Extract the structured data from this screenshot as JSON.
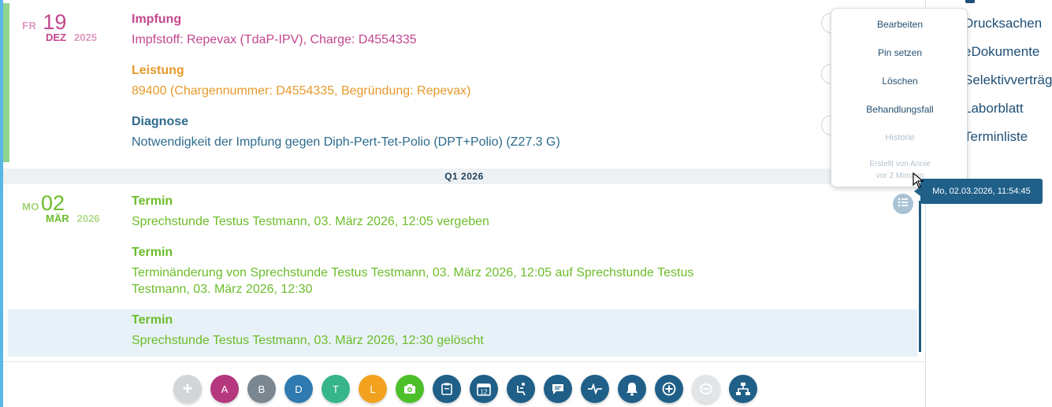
{
  "entries": {
    "dec": {
      "weekday": "FR",
      "day": "19",
      "month": "DEZ",
      "year": "2025",
      "items": [
        {
          "title": "Impfung",
          "text": "Impfstoff: Repevax (TdaP-IPV), Charge: D4554335"
        },
        {
          "title": "Leistung",
          "text": "89400 (Chargennummer: D4554335, Begründung: Repevax)"
        },
        {
          "title": "Diagnose",
          "text": "Notwendigkeit der Impfung gegen Diph-Pert-Tet-Polio (DPT+Polio) (Z27.3 G)"
        }
      ]
    },
    "quarter": "Q1  2026",
    "mar": {
      "weekday": "MO",
      "day": "02",
      "month": "MÄR",
      "year": "2026",
      "items": [
        {
          "title": "Termin",
          "text": "Sprechstunde Testus Testmann, 03. März 2026, 12:05 vergeben"
        },
        {
          "title": "Termin",
          "text": "Terminänderung von Sprechstunde Testus Testmann, 03. März 2026, 12:05 auf Sprechstunde Testus",
          "text2": "Testmann, 03. März 2026, 12:30"
        },
        {
          "title": "Termin",
          "text": "Sprechstunde Testus Testmann, 03. März 2026, 12:30 gelöscht"
        }
      ]
    }
  },
  "context_menu": {
    "items": [
      "Bearbeiten",
      "Pin setzen",
      "Löschen",
      "Behandlungsfall",
      "Historie"
    ],
    "created_line1": "Erstellt von Annie",
    "created_line2": "vor 2 Minuten"
  },
  "tooltip": "Mo, 02.03.2026, 11:54:45",
  "right_panel": {
    "items": [
      "Drucksachen",
      "eDokumente",
      "Selektivverträge",
      "Laborblatt",
      "Terminliste"
    ]
  },
  "toolbar": {
    "buttons": [
      {
        "name": "add",
        "label": "+",
        "color": "#d3d6d9"
      },
      {
        "name": "a",
        "label": "A",
        "color": "#b5377e"
      },
      {
        "name": "b",
        "label": "B",
        "color": "#7a8791"
      },
      {
        "name": "d",
        "label": "D",
        "color": "#2f7ab0"
      },
      {
        "name": "t",
        "label": "T",
        "color": "#36b58c"
      },
      {
        "name": "l",
        "label": "L",
        "color": "#f2a21f"
      },
      {
        "name": "camera",
        "icon": "camera-icon",
        "color": "#4cc02a"
      },
      {
        "name": "clipboard",
        "icon": "clipboard-icon",
        "color": "#1f5f88"
      },
      {
        "name": "calendar",
        "icon": "calendar-icon",
        "color": "#1f5f88",
        "label": "12"
      },
      {
        "name": "seat",
        "icon": "seat-icon",
        "color": "#1f5f88"
      },
      {
        "name": "chat",
        "icon": "chat-icon",
        "color": "#1f5f88"
      },
      {
        "name": "pulse",
        "icon": "pulse-icon",
        "color": "#1f5f88"
      },
      {
        "name": "bell",
        "icon": "bell-icon",
        "color": "#1f5f88"
      },
      {
        "name": "plus-circle",
        "icon": "plus-circle-icon",
        "color": "#1f5f88"
      },
      {
        "name": "message-disabled",
        "icon": "message-off-icon",
        "color": "#e2e5e8"
      },
      {
        "name": "hierarchy",
        "icon": "hierarchy-icon",
        "color": "#1f5f88"
      }
    ]
  },
  "colors": {
    "impfung": "#c2478e",
    "leistung": "#e69a2c",
    "diagnose": "#2d6b8d",
    "termin": "#6cbd2a",
    "accent": "#1f5f88"
  }
}
